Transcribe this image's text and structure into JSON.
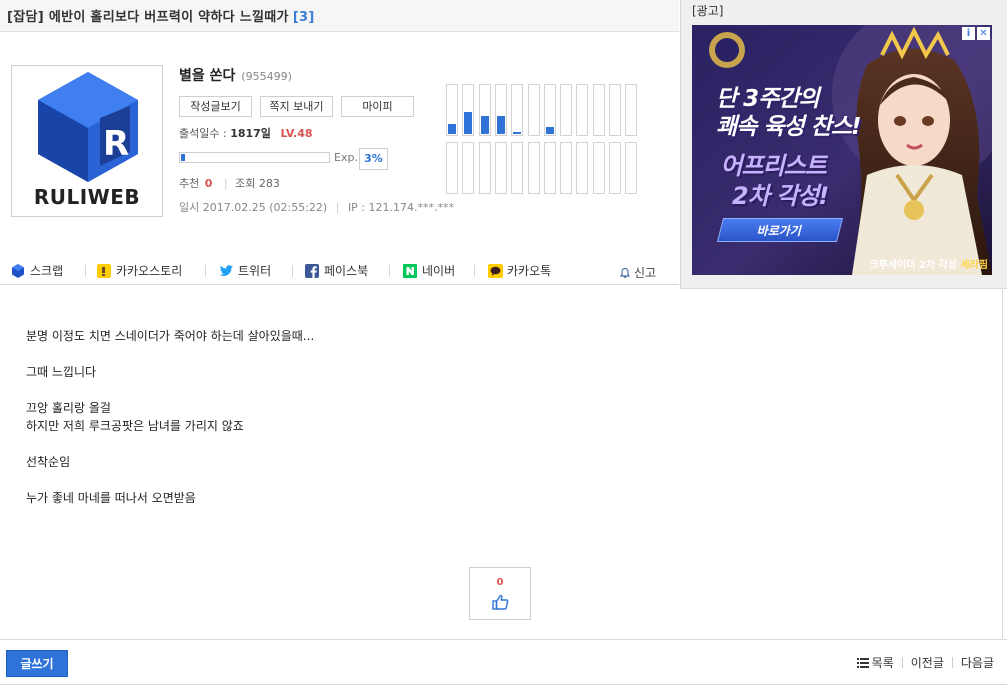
{
  "post": {
    "title": "[잡담] 에반이 홀리보다 버프력이 약하다 느낄때가",
    "comment_count": "[3]"
  },
  "profile": {
    "logo_text": "RULIWEB",
    "name": "별을 쏜다",
    "user_id": "(955499)",
    "buttons": [
      "작성글보기",
      "쪽지 보내기",
      "마이피"
    ],
    "attendance_label": "출석일수 :",
    "attendance_value": "1817일",
    "level": "LV.48",
    "exp_label": "Exp.",
    "exp_percent": "3%",
    "exp_fraction": 0.03,
    "recommend_label": "추천",
    "recommend_value": "0",
    "views_label": "조회",
    "views_value": "283",
    "posted_label": "일시",
    "posted_value": "2017.02.25 (02:55:22)",
    "ip_label": "IP :",
    "ip_value": "121.174.***.***",
    "activity_levels": [
      0.2,
      0.45,
      0.38,
      0.38,
      0.05,
      0,
      0.15,
      0,
      0,
      0,
      0,
      0
    ],
    "accent_color": "#2f73d9"
  },
  "share": {
    "items": [
      {
        "label": "스크랩",
        "icon": "scrap-icon"
      },
      {
        "label": "카카오스토리",
        "icon": "kakaostory-icon"
      },
      {
        "label": "트위터",
        "icon": "twitter-icon"
      },
      {
        "label": "페이스북",
        "icon": "facebook-icon"
      },
      {
        "label": "네이버",
        "icon": "naver-icon"
      },
      {
        "label": "카카오톡",
        "icon": "kakaotalk-icon"
      }
    ],
    "report_label": "신고"
  },
  "ad": {
    "label": "[광고]",
    "headline1": "단 3주간의",
    "headline2": "쾌속 육성 찬스!",
    "subhead1": "어프리스트",
    "subhead2": "2차 각성!",
    "cta": "바로가기",
    "footer_prefix": "크루세이더 2차 각성",
    "footer_highlight": "세라핌"
  },
  "body": {
    "lines": [
      "분명 이정도 치면 스네이더가 죽어야 하는데 살아있을때...",
      "",
      "그때 느낍니다",
      "",
      "끄앙 홀리랑 올걸",
      "하지만 저희 루크공팟은 남녀를 가리지 않죠",
      "",
      "선착순임",
      "",
      "누가 좋네 마네를 떠나서 오면받음"
    ]
  },
  "like": {
    "count": "0"
  },
  "footer": {
    "write_label": "글쓰기",
    "list_label": "목록",
    "prev_label": "이전글",
    "next_label": "다음글"
  }
}
